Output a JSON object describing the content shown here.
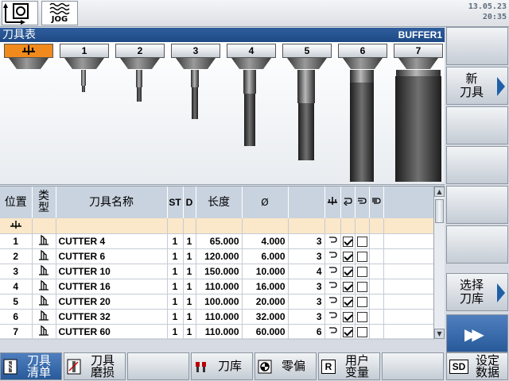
{
  "status": {
    "mode_label": "JOG",
    "date": "13.05.23",
    "time": "20:35"
  },
  "header": {
    "title": "刀具表",
    "buffer": "BUFFER1"
  },
  "holders": [
    "",
    "1",
    "2",
    "3",
    "4",
    "5",
    "6",
    "7"
  ],
  "table": {
    "columns": {
      "pos": "位置",
      "type": "类型",
      "name": "刀具名称",
      "st": "ST",
      "d": "D",
      "length": "长度",
      "dia": "Ø"
    },
    "rows": [
      {
        "pos": "1",
        "name": "CUTTER 4",
        "st": "1",
        "d": "1",
        "length": "65.000",
        "dia": "4.000",
        "teeth": "3",
        "checked": true
      },
      {
        "pos": "2",
        "name": "CUTTER 6",
        "st": "1",
        "d": "1",
        "length": "120.000",
        "dia": "6.000",
        "teeth": "3",
        "checked": true
      },
      {
        "pos": "3",
        "name": "CUTTER 10",
        "st": "1",
        "d": "1",
        "length": "150.000",
        "dia": "10.000",
        "teeth": "4",
        "checked": true
      },
      {
        "pos": "4",
        "name": "CUTTER 16",
        "st": "1",
        "d": "1",
        "length": "110.000",
        "dia": "16.000",
        "teeth": "3",
        "checked": true
      },
      {
        "pos": "5",
        "name": "CUTTER 20",
        "st": "1",
        "d": "1",
        "length": "100.000",
        "dia": "20.000",
        "teeth": "3",
        "checked": true
      },
      {
        "pos": "6",
        "name": "CUTTER 32",
        "st": "1",
        "d": "1",
        "length": "110.000",
        "dia": "32.000",
        "teeth": "3",
        "checked": true
      },
      {
        "pos": "7",
        "name": "CUTTER 60",
        "st": "1",
        "d": "1",
        "length": "110.000",
        "dia": "60.000",
        "teeth": "6",
        "checked": true
      }
    ]
  },
  "softkeys_right": {
    "new_tool": [
      "新",
      "刀具"
    ],
    "select_magazine": [
      "选择",
      "刀库"
    ]
  },
  "softkeys_bottom": {
    "tool_list": [
      "刀具",
      "清单"
    ],
    "tool_wear": [
      "刀具",
      "磨损"
    ],
    "magazine": "刀库",
    "work_offset": "零偏",
    "user_var": [
      "用户",
      "变量"
    ],
    "setting_data": [
      "设定",
      "数据"
    ],
    "user_var_icon": "R",
    "setting_icon": "SD"
  },
  "colors": {
    "title_bar": "#1e4a86",
    "accent": "#1f5fa8",
    "selected_holder": "#f08a1c",
    "spindle_row": "#fbe7c9"
  }
}
